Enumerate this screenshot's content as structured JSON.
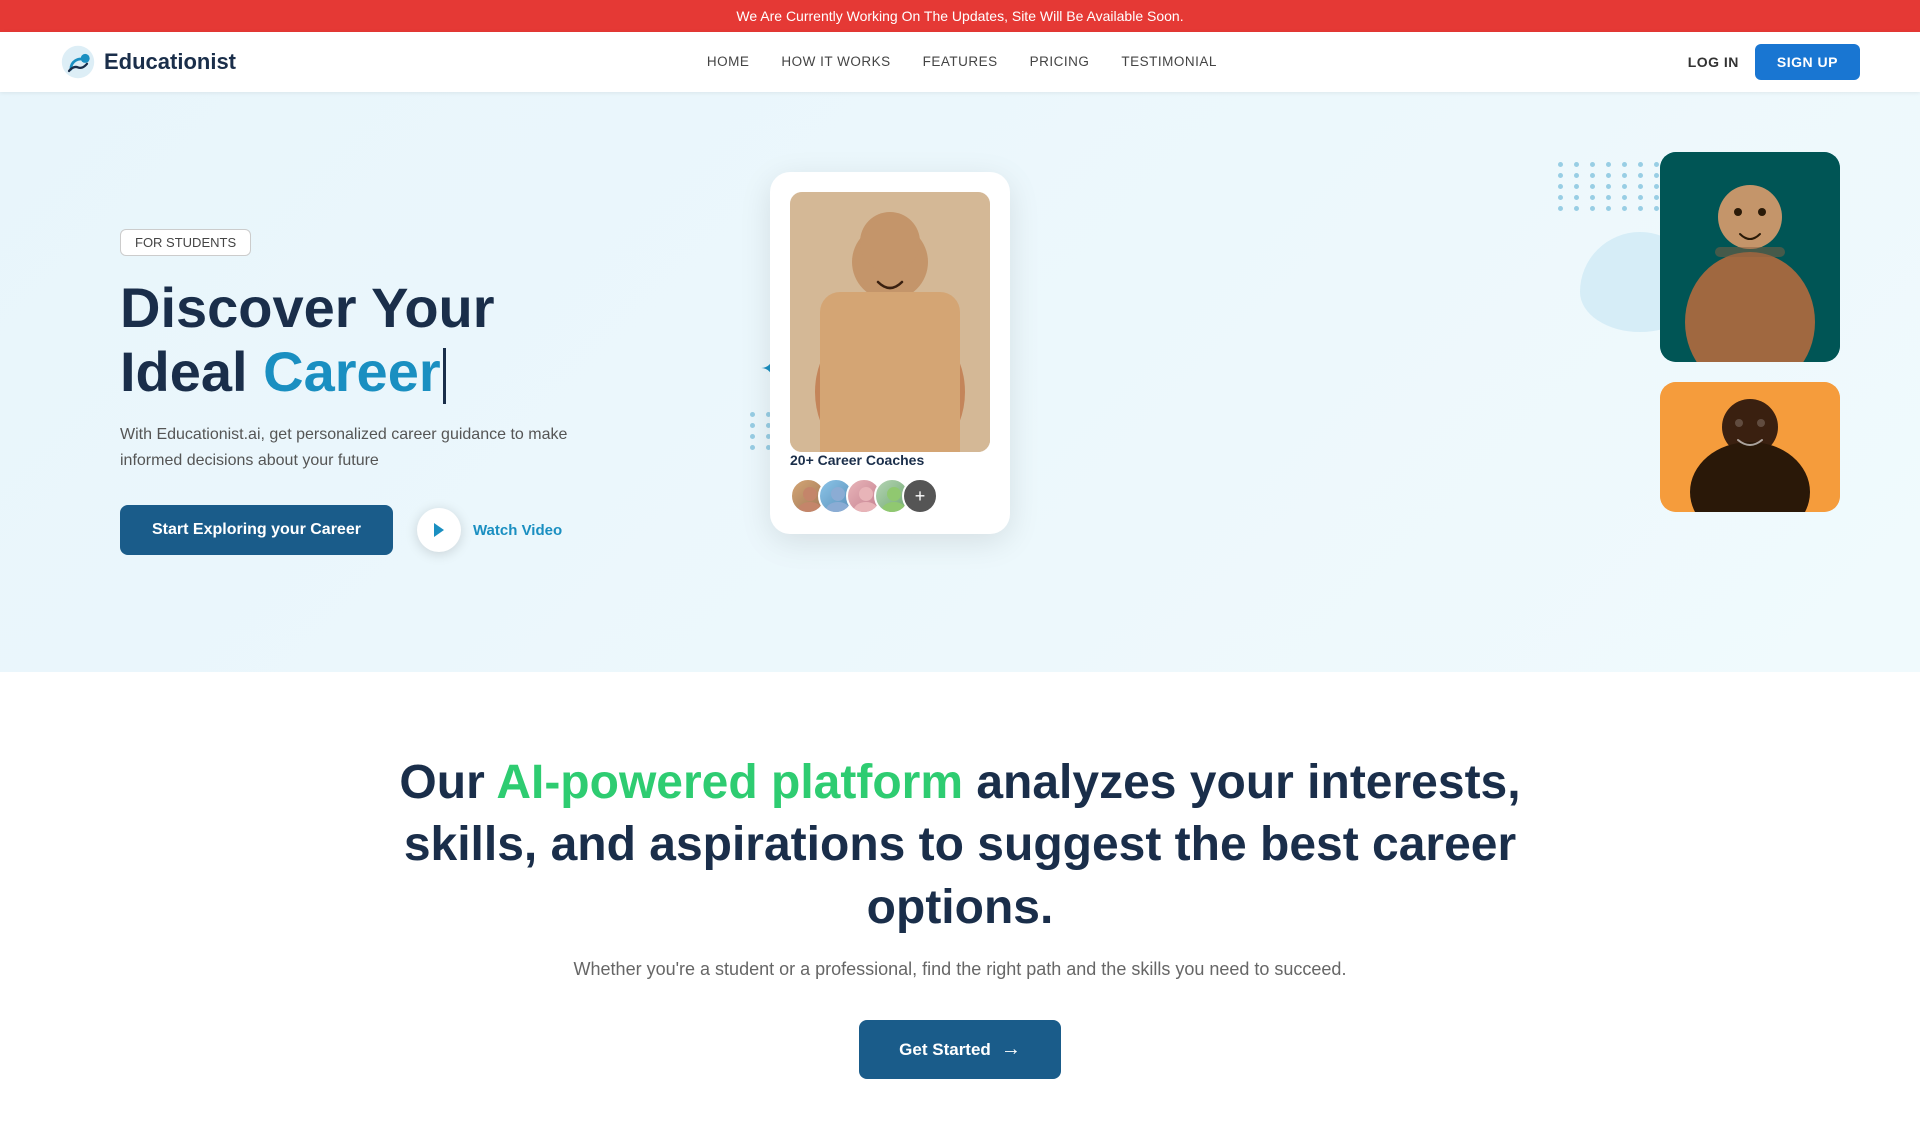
{
  "banner": {
    "text": "We Are Currently Working On The Updates, Site Will Be Available Soon."
  },
  "navbar": {
    "logo_text": "Educationist",
    "links": [
      {
        "label": "HOME",
        "id": "home"
      },
      {
        "label": "HOW IT WORKS",
        "id": "how-it-works"
      },
      {
        "label": "FEATURES",
        "id": "features"
      },
      {
        "label": "PRICING",
        "id": "pricing"
      },
      {
        "label": "TESTIMONIAL",
        "id": "testimonial"
      }
    ],
    "login_label": "LOG IN",
    "signup_label": "SIGN UP"
  },
  "hero": {
    "badge": "FOR STUDENTS",
    "title_line1": "Discover Your",
    "title_line2": "Ideal ",
    "title_highlight": "Career",
    "description": "With Educationist.ai, get personalized career guidance to make informed decisions about your future",
    "cta_primary": "Start Exploring your Career",
    "cta_secondary": "Watch Video",
    "coaches_label": "20+ Career Coaches"
  },
  "section_ai": {
    "prefix": "Our ",
    "highlight": "AI-powered platform",
    "suffix": " analyzes your interests,\nskills, and aspirations to suggest the best career\noptions.",
    "subtitle": "Whether you're a student or a professional, find the right path and the skills you need to succeed.",
    "cta": "Get Started",
    "cta_arrow": "→"
  }
}
